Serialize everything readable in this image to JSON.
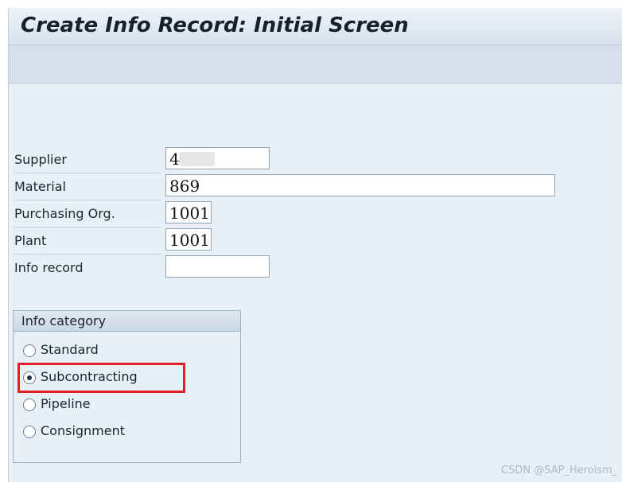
{
  "title": "Create Info Record: Initial Screen",
  "fields": [
    {
      "label": "Supplier",
      "value": "4"
    },
    {
      "label": "Material",
      "value": "869"
    },
    {
      "label": "Purchasing Org.",
      "value": "1001"
    },
    {
      "label": "Plant",
      "value": "1001"
    },
    {
      "label": "Info record",
      "value": ""
    }
  ],
  "info_category": {
    "title": "Info category",
    "options": [
      {
        "label": "Standard",
        "selected": false
      },
      {
        "label": "Subcontracting",
        "selected": true
      },
      {
        "label": "Pipeline",
        "selected": false
      },
      {
        "label": "Consignment",
        "selected": false
      }
    ]
  },
  "colors": {
    "highlight": "#e02028",
    "background": "#e8eff6"
  },
  "watermark": "CSDN @SAP_Heroism_"
}
